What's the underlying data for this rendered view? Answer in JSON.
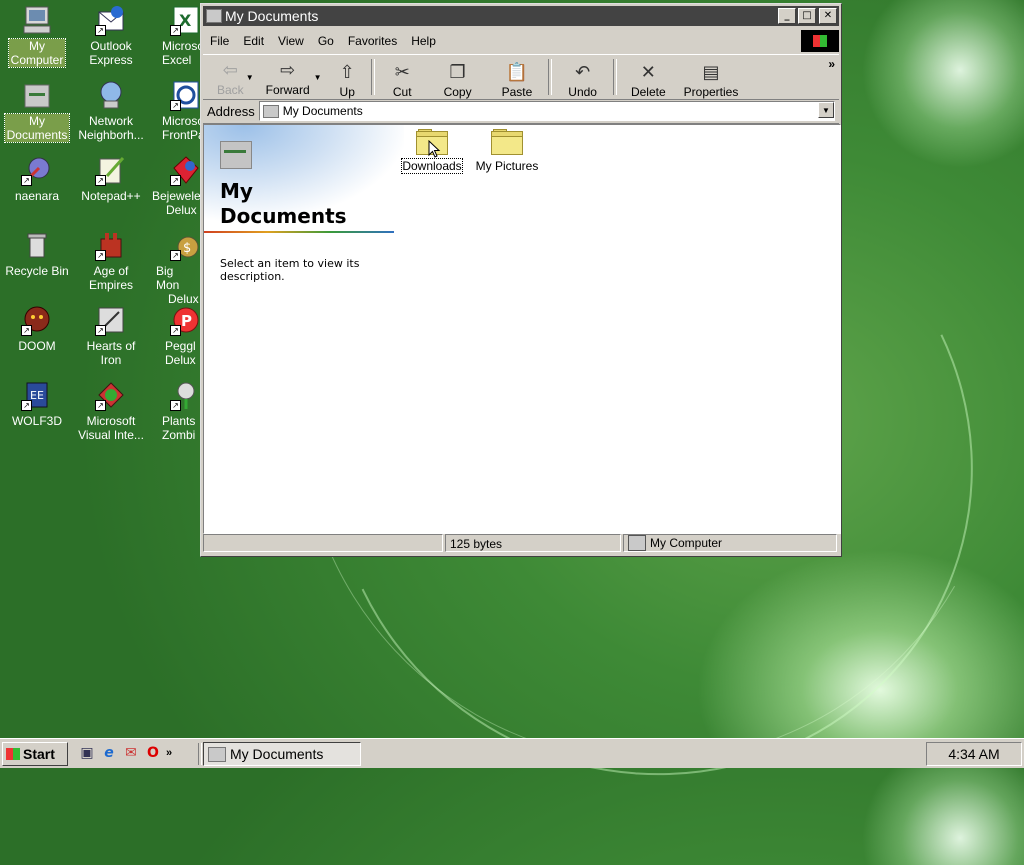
{
  "desktop": {
    "icons": [
      {
        "label_lines": [
          "My",
          "Computer"
        ],
        "icon": "my-computer-icon"
      },
      {
        "label_lines": [
          "Outlook",
          "Express"
        ],
        "icon": "outlook-express-icon"
      },
      {
        "label_lines": [
          "Microsc",
          "Excel"
        ],
        "icon": "excel-icon"
      },
      {
        "label_lines": [
          "My",
          "Documents"
        ],
        "icon": "my-documents-icon"
      },
      {
        "label_lines": [
          "Network",
          "Neighborh..."
        ],
        "icon": "network-icon"
      },
      {
        "label_lines": [
          "Microsc",
          "FrontPa"
        ],
        "icon": "frontpage-icon"
      },
      {
        "label_lines": [
          "naenara"
        ],
        "icon": "naenara-icon"
      },
      {
        "label_lines": [
          "Notepad++"
        ],
        "icon": "notepad-icon"
      },
      {
        "label_lines": [
          "Bejewele",
          "Delux"
        ],
        "icon": "bejeweled-icon"
      },
      {
        "label_lines": [
          "Recycle Bin"
        ],
        "icon": "recycle-bin-icon"
      },
      {
        "label_lines": [
          "Age of",
          "Empires"
        ],
        "icon": "age-of-empires-icon"
      },
      {
        "label_lines": [
          "Big Mon",
          "Delux"
        ],
        "icon": "big-money-icon"
      },
      {
        "label_lines": [
          "DOOM"
        ],
        "icon": "doom-icon"
      },
      {
        "label_lines": [
          "Hearts of",
          "Iron"
        ],
        "icon": "hearts-of-iron-icon"
      },
      {
        "label_lines": [
          "Peggl",
          "Delux"
        ],
        "icon": "peggle-icon"
      },
      {
        "label_lines": [
          "WOLF3D"
        ],
        "icon": "wolf3d-icon"
      },
      {
        "label_lines": [
          "Microsoft",
          "Visual Inte..."
        ],
        "icon": "visual-interdev-icon"
      },
      {
        "label_lines": [
          "Plants",
          "Zombi"
        ],
        "icon": "plants-zombies-icon"
      }
    ]
  },
  "window": {
    "title": "My Documents",
    "menu": [
      "File",
      "Edit",
      "View",
      "Go",
      "Favorites",
      "Help"
    ],
    "toolbar": {
      "back": "Back",
      "forward": "Forward",
      "up": "Up",
      "cut": "Cut",
      "copy": "Copy",
      "paste": "Paste",
      "undo": "Undo",
      "delete": "Delete",
      "properties": "Properties",
      "more": "»"
    },
    "address": {
      "label": "Address",
      "value": "My Documents"
    },
    "left_pane": {
      "title_line1": "My",
      "title_line2": "Documents",
      "description": "Select an item to view its description."
    },
    "files": [
      {
        "name": "Downloads",
        "icon": "folder-icon"
      },
      {
        "name": "My Pictures",
        "icon": "folder-icon"
      }
    ],
    "status": {
      "size": "125 bytes",
      "zone": "My Computer"
    }
  },
  "taskbar": {
    "start": "Start",
    "quicklaunch_more": "»",
    "task": "My Documents",
    "clock": "4:34 AM"
  }
}
